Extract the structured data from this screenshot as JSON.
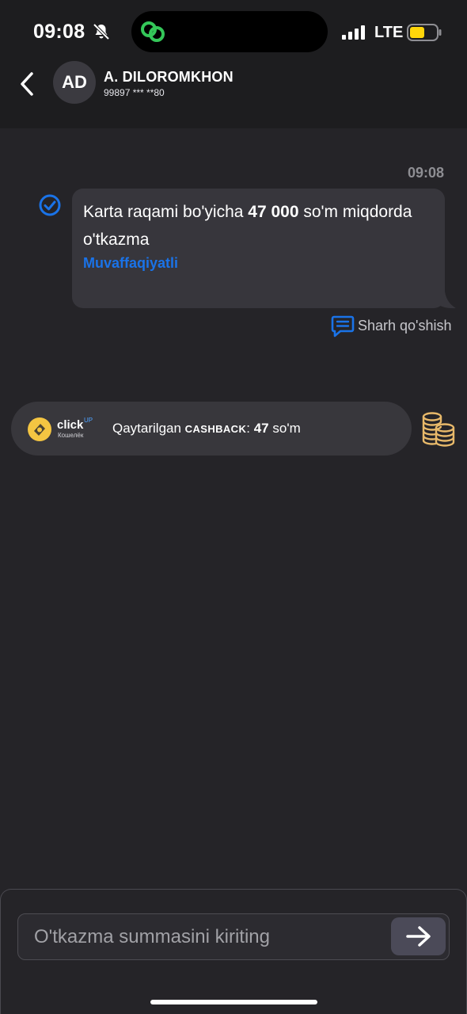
{
  "status_bar": {
    "time": "09:08",
    "network": "LTE",
    "icons": [
      "bell-slash-icon",
      "linked-rings-icon",
      "signal-icon",
      "battery-icon"
    ],
    "colors": {
      "battery": "#ffd60a",
      "island_icon": "#34c759"
    }
  },
  "header": {
    "avatar_initials": "AD",
    "contact_name": "A. DILOROMKHON",
    "contact_phone": "99897 *** **80"
  },
  "message": {
    "time": "09:08",
    "text_prefix": "Karta raqami bo'yicha ",
    "amount": "47 000",
    "text_suffix": " so'm miqdorda o'tkazma",
    "status": "Muvaffaqiyatli",
    "comment_label": "Sharh qo'shish",
    "colors": {
      "status": "#1a73e8",
      "check": "#1a73e8"
    }
  },
  "cashback": {
    "brand_word": "click",
    "brand_superscript": "UP",
    "brand_sub": "Кошелёк",
    "label": "Qaytarilgan ",
    "label_caps": "CASHBACK",
    "separator": ": ",
    "amount": "47",
    "currency": " so'm",
    "colors": {
      "logo": "#f4c542",
      "coins": "#e8b96a"
    }
  },
  "input": {
    "placeholder": "O'tkazma summasini kiriting",
    "value": ""
  }
}
